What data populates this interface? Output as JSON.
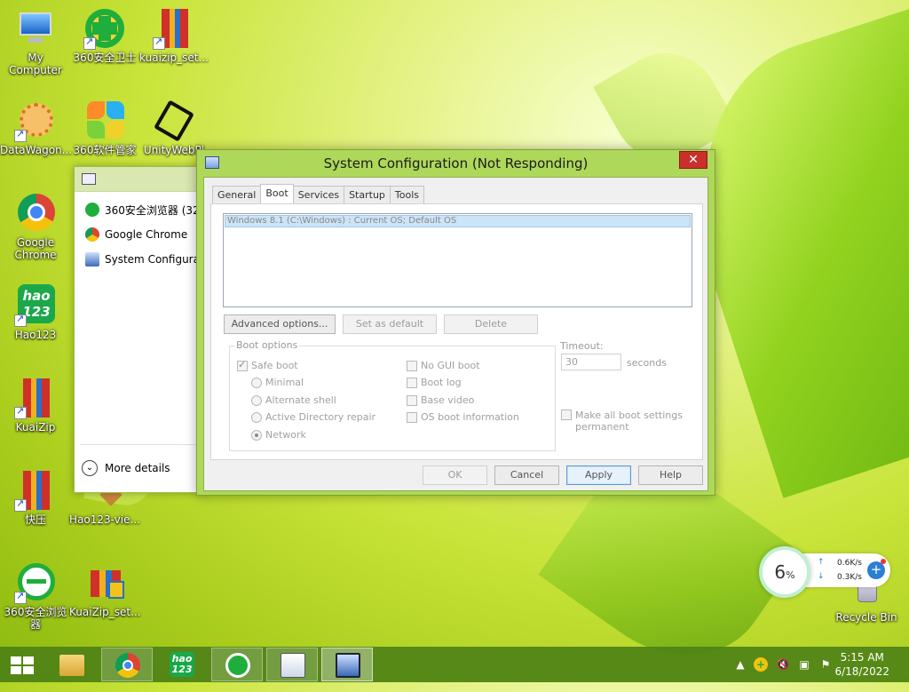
{
  "desktop": {
    "icons": [
      {
        "label": "My Computer"
      },
      {
        "label": "360安全卫士"
      },
      {
        "label": "kuaizip_set..."
      },
      {
        "label": "DataWagon..."
      },
      {
        "label": "360软件管家"
      },
      {
        "label": "UnityWebPl"
      },
      {
        "label": "Google Chrome"
      },
      {
        "label": "Hao123"
      },
      {
        "label": "KuaiZip"
      },
      {
        "label": "快压"
      },
      {
        "label": "Hao123-vie..."
      },
      {
        "label": "360安全浏览器"
      },
      {
        "label": "KuaiZip_set..."
      },
      {
        "label": "Recycle Bin"
      }
    ]
  },
  "task_manager": {
    "items": [
      {
        "label": "360安全浏览器 (32"
      },
      {
        "label": "Google Chrome"
      },
      {
        "label": "System Configurati"
      }
    ],
    "more_details": "More details"
  },
  "dialog": {
    "title": "System Configuration (Not Responding)",
    "close": "✕",
    "tabs": [
      {
        "label": "General"
      },
      {
        "label": "Boot"
      },
      {
        "label": "Services"
      },
      {
        "label": "Startup"
      },
      {
        "label": "Tools"
      }
    ],
    "active_tab": "Boot",
    "os_list": [
      "Windows 8.1 (C:\\Windows) : Current OS; Default OS"
    ],
    "buttons": {
      "advanced": "Advanced options...",
      "set_default": "Set as default",
      "delete": "Delete"
    },
    "boot_options": {
      "legend": "Boot options",
      "safe_boot": {
        "label": "Safe boot",
        "checked": true
      },
      "radios": [
        {
          "label": "Minimal",
          "checked": false
        },
        {
          "label": "Alternate shell",
          "checked": false
        },
        {
          "label": "Active Directory repair",
          "checked": false
        },
        {
          "label": "Network",
          "checked": true
        }
      ],
      "checks": [
        {
          "label": "No GUI boot",
          "checked": false
        },
        {
          "label": "Boot log",
          "checked": false
        },
        {
          "label": "Base video",
          "checked": false
        },
        {
          "label": "OS boot information",
          "checked": false
        }
      ]
    },
    "timeout": {
      "label": "Timeout:",
      "value": "30",
      "unit": "seconds"
    },
    "permanent": {
      "label_line1": "Make all boot settings",
      "label_line2": "permanent",
      "checked": false
    },
    "footer": {
      "ok": "OK",
      "cancel": "Cancel",
      "apply": "Apply",
      "help": "Help"
    }
  },
  "net_widget": {
    "percent": "6",
    "percent_sign": "%",
    "up": "0.6K/s",
    "down": "0.3K/s",
    "up_arrow": "↑",
    "down_arrow": "↓",
    "plus": "+"
  },
  "taskbar": {
    "items": [
      {
        "name": "start-button",
        "icon": "windows-logo-icon"
      },
      {
        "name": "file-explorer",
        "icon": "folder-icon"
      },
      {
        "name": "google-chrome",
        "icon": "chrome-icon"
      },
      {
        "name": "hao123",
        "icon": "hao123-icon",
        "text": "hao\n123"
      },
      {
        "name": "360-browser",
        "icon": "360-browser-icon"
      },
      {
        "name": "task-manager",
        "icon": "task-manager-icon"
      },
      {
        "name": "system-configuration",
        "icon": "msconfig-icon"
      }
    ],
    "tray_arrow": "▲",
    "time": "5:15 AM",
    "date": "6/18/2022"
  },
  "colors": {
    "taskbar": "#4e8216",
    "close_button": "#c9302c",
    "accent": "#2a7fd4"
  }
}
